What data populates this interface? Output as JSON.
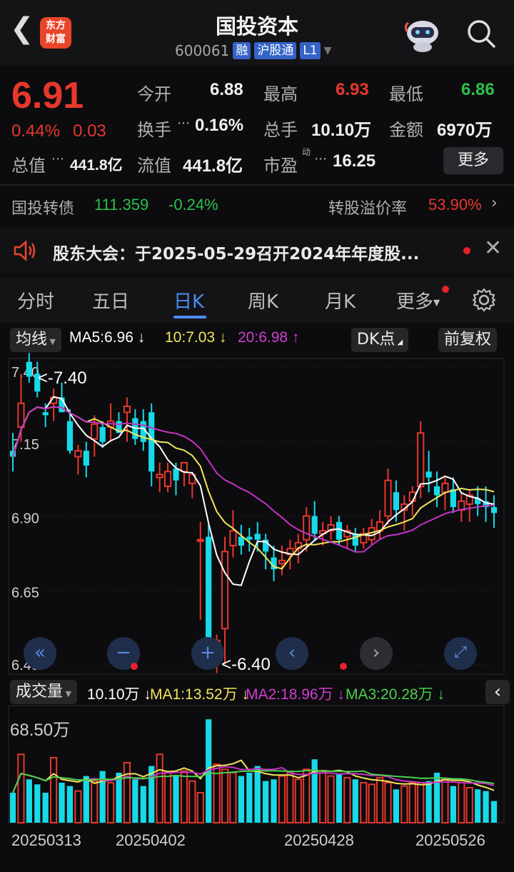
{
  "header": {
    "title": "国投资本",
    "code": "600061",
    "tags": [
      "融",
      "沪股通",
      "L1"
    ],
    "logo_line1": "东方",
    "logo_line2": "财富"
  },
  "quote": {
    "price": "6.91",
    "pct": "0.44%",
    "chg": "0.03",
    "open_label": "今开",
    "open": "6.88",
    "high_label": "最高",
    "high": "6.93",
    "low_label": "最低",
    "low": "6.86",
    "turnover_label": "换手",
    "turnover": "0.16%",
    "volume_label": "总手",
    "volume": "10.10万",
    "amount_label": "金额",
    "amount": "6970万",
    "mcap_label": "总值",
    "mcap": "441.8亿",
    "float_label": "流值",
    "float": "441.8亿",
    "pe_label": "市盈",
    "pe_sup": "动",
    "pe": "16.25",
    "more": "更多"
  },
  "bond": {
    "label": "国投转债",
    "price": "111.359",
    "pct": "-0.24%",
    "premium_label": "转股溢价率",
    "premium": "53.90%"
  },
  "notice": {
    "text": "股东大会：于2025-05-29召开2024年年度股..."
  },
  "tabs": [
    "分时",
    "五日",
    "日K",
    "周K",
    "月K",
    "更多"
  ],
  "kline_bar": {
    "indicator": "均线",
    "ma5": "MA5:6.96",
    "ma10": "10:7.03",
    "ma20": "20:6.98",
    "dk": "DK点",
    "adjust": "前复权"
  },
  "price_axis": [
    "7.40",
    "7.15",
    "6.90",
    "6.65",
    "6.40"
  ],
  "annotations": {
    "max": "<-7.40",
    "min": "<-6.40"
  },
  "volume_bar": {
    "indicator": "成交量",
    "vol": "10.10万",
    "ma1": "MA1:13.52万",
    "ma2": "MA2:18.96万",
    "ma3": "MA3:20.28万",
    "ymax": "68.50万"
  },
  "dates": [
    "20250313",
    "20250402",
    "20250428",
    "20250526"
  ],
  "colors": {
    "up": "#e8372c",
    "down": "#17d9e8",
    "ma5": "#ffffff",
    "ma10": "#f2e45c",
    "ma20": "#c433c4",
    "vma3": "#4cd04c"
  },
  "chart_data": {
    "type": "candlestick",
    "candles": [
      [
        7.12,
        7.18,
        7.05,
        7.1
      ],
      [
        7.2,
        7.38,
        7.15,
        7.28
      ],
      [
        7.42,
        7.45,
        7.35,
        7.37
      ],
      [
        7.38,
        7.42,
        7.3,
        7.32
      ],
      [
        7.25,
        7.28,
        7.2,
        7.24
      ],
      [
        7.28,
        7.33,
        7.22,
        7.3
      ],
      [
        7.3,
        7.35,
        7.25,
        7.25
      ],
      [
        7.22,
        7.26,
        7.11,
        7.12
      ],
      [
        7.1,
        7.14,
        7.04,
        7.12
      ],
      [
        7.12,
        7.15,
        7.03,
        7.07
      ],
      [
        7.16,
        7.24,
        7.1,
        7.21
      ],
      [
        7.2,
        7.22,
        7.13,
        7.15
      ],
      [
        7.2,
        7.28,
        7.15,
        7.22
      ],
      [
        7.22,
        7.25,
        7.18,
        7.18
      ],
      [
        7.25,
        7.3,
        7.15,
        7.27
      ],
      [
        7.23,
        7.26,
        7.14,
        7.16
      ],
      [
        7.22,
        7.26,
        7.12,
        7.15
      ],
      [
        7.25,
        7.28,
        7.0,
        7.05
      ],
      [
        7.03,
        7.08,
        6.98,
        7.04
      ],
      [
        7.0,
        7.08,
        6.98,
        7.05
      ],
      [
        7.06,
        7.08,
        6.97,
        7.02
      ],
      [
        7.05,
        7.08,
        7.0,
        7.08
      ],
      [
        7.01,
        7.04,
        6.96,
        7.04
      ],
      [
        6.82,
        6.88,
        6.55,
        6.82
      ],
      [
        6.83,
        6.87,
        6.4,
        6.42
      ],
      [
        6.45,
        6.5,
        6.37,
        6.48
      ],
      [
        6.52,
        6.83,
        6.4,
        6.78
      ],
      [
        6.8,
        6.92,
        6.76,
        6.85
      ],
      [
        6.83,
        6.87,
        6.77,
        6.8
      ],
      [
        6.83,
        6.86,
        6.78,
        6.82
      ],
      [
        6.84,
        6.88,
        6.78,
        6.82
      ],
      [
        6.82,
        6.84,
        6.72,
        6.78
      ],
      [
        6.76,
        6.8,
        6.68,
        6.72
      ],
      [
        6.74,
        6.8,
        6.7,
        6.75
      ],
      [
        6.77,
        6.82,
        6.72,
        6.79
      ],
      [
        6.79,
        6.84,
        6.74,
        6.81
      ],
      [
        6.82,
        6.93,
        6.78,
        6.9
      ],
      [
        6.9,
        6.95,
        6.82,
        6.84
      ],
      [
        6.84,
        6.88,
        6.8,
        6.85
      ],
      [
        6.85,
        6.9,
        6.82,
        6.87
      ],
      [
        6.88,
        6.9,
        6.8,
        6.82
      ],
      [
        6.83,
        6.87,
        6.79,
        6.85
      ],
      [
        6.84,
        6.86,
        6.78,
        6.8
      ],
      [
        6.81,
        6.86,
        6.79,
        6.84
      ],
      [
        6.82,
        6.89,
        6.8,
        6.86
      ],
      [
        6.85,
        6.92,
        6.82,
        6.88
      ],
      [
        6.9,
        7.06,
        6.87,
        7.02
      ],
      [
        6.98,
        7.02,
        6.88,
        6.92
      ],
      [
        6.92,
        6.97,
        6.85,
        6.94
      ],
      [
        6.95,
        7.0,
        6.9,
        6.98
      ],
      [
        7.0,
        7.22,
        6.96,
        7.18
      ],
      [
        7.05,
        7.12,
        6.98,
        7.03
      ],
      [
        7.0,
        7.05,
        6.93,
        6.97
      ],
      [
        6.98,
        7.03,
        6.92,
        7.01
      ],
      [
        6.99,
        7.03,
        6.91,
        6.93
      ],
      [
        6.92,
        6.98,
        6.88,
        6.95
      ],
      [
        6.94,
        6.99,
        6.88,
        6.97
      ],
      [
        6.96,
        7.0,
        6.9,
        6.94
      ],
      [
        6.95,
        7.0,
        6.88,
        6.93
      ],
      [
        6.93,
        6.97,
        6.86,
        6.91
      ]
    ],
    "volume": [
      18,
      41,
      26,
      23,
      18,
      39,
      24,
      22,
      19,
      28,
      25,
      31,
      24,
      30,
      36,
      26,
      22,
      34,
      41,
      30,
      28,
      31,
      25,
      18,
      62,
      35,
      32,
      30,
      28,
      30,
      34,
      25,
      26,
      28,
      30,
      26,
      32,
      38,
      30,
      28,
      29,
      27,
      26,
      24,
      23,
      27,
      24,
      20,
      22,
      24,
      24,
      25,
      30,
      26,
      22,
      24,
      21,
      20,
      19,
      13
    ],
    "x_ticks": [
      "20250313",
      "20250402",
      "20250428",
      "20250526"
    ],
    "y_range": [
      6.4,
      7.4
    ]
  }
}
